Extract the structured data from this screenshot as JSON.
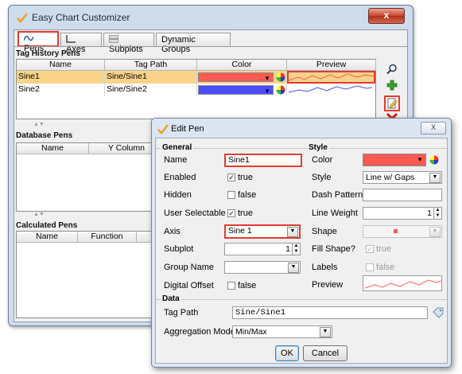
{
  "window": {
    "title": "Easy Chart Customizer",
    "close_label": "x"
  },
  "tabs": [
    {
      "label": "Pens",
      "selected": true
    },
    {
      "label": "Axes"
    },
    {
      "label": "Subplots"
    },
    {
      "label": "Dynamic Groups"
    }
  ],
  "tag_history": {
    "title": "Tag History Pens",
    "columns": [
      "Name",
      "Tag Path",
      "Color",
      "Preview"
    ],
    "rows": [
      {
        "name": "Sine1",
        "path": "Sine/Sine1",
        "color": "#ff5a52"
      },
      {
        "name": "Sine2",
        "path": "Sine/Sine2",
        "color": "#4b4bff"
      }
    ]
  },
  "database": {
    "title": "Database Pens",
    "columns": [
      "Name",
      "Y Column"
    ]
  },
  "calculated": {
    "title": "Calculated Pens",
    "columns": [
      "Name",
      "Function"
    ]
  },
  "edit_pen": {
    "title": "Edit Pen",
    "close_label": "X",
    "general": {
      "header": "General",
      "name_label": "Name",
      "name_value": "Sine1",
      "enabled_label": "Enabled",
      "enabled_value": "true",
      "hidden_label": "Hidden",
      "hidden_value": "false",
      "user_selectable_label": "User Selectable",
      "user_selectable_value": "true",
      "axis_label": "Axis",
      "axis_value": "Sine 1",
      "subplot_label": "Subplot",
      "subplot_value": "1",
      "group_name_label": "Group Name",
      "group_name_value": "",
      "digital_offset_label": "Digital Offset",
      "digital_offset_value": "false"
    },
    "style": {
      "header": "Style",
      "color_label": "Color",
      "color_value": "#ff5a52",
      "style_label": "Style",
      "style_value": "Line w/ Gaps",
      "dash_label": "Dash Pattern",
      "dash_value": "",
      "weight_label": "Line Weight",
      "weight_value": "1",
      "shape_label": "Shape",
      "fill_label": "Fill Shape?",
      "fill_value": "true",
      "labels_label": "Labels",
      "labels_value": "false",
      "preview_label": "Preview"
    },
    "data": {
      "header": "Data",
      "tag_path_label": "Tag Path",
      "tag_path_value": "Sine/Sine1",
      "agg_label": "Aggregation Mode",
      "agg_value": "Min/Max"
    },
    "ok_label": "OK",
    "cancel_label": "Cancel"
  },
  "icons": [
    "search-icon",
    "add-icon",
    "edit-icon",
    "delete-icon",
    "color-wheel-icon",
    "tag-browse-icon",
    "app-logo-icon"
  ]
}
